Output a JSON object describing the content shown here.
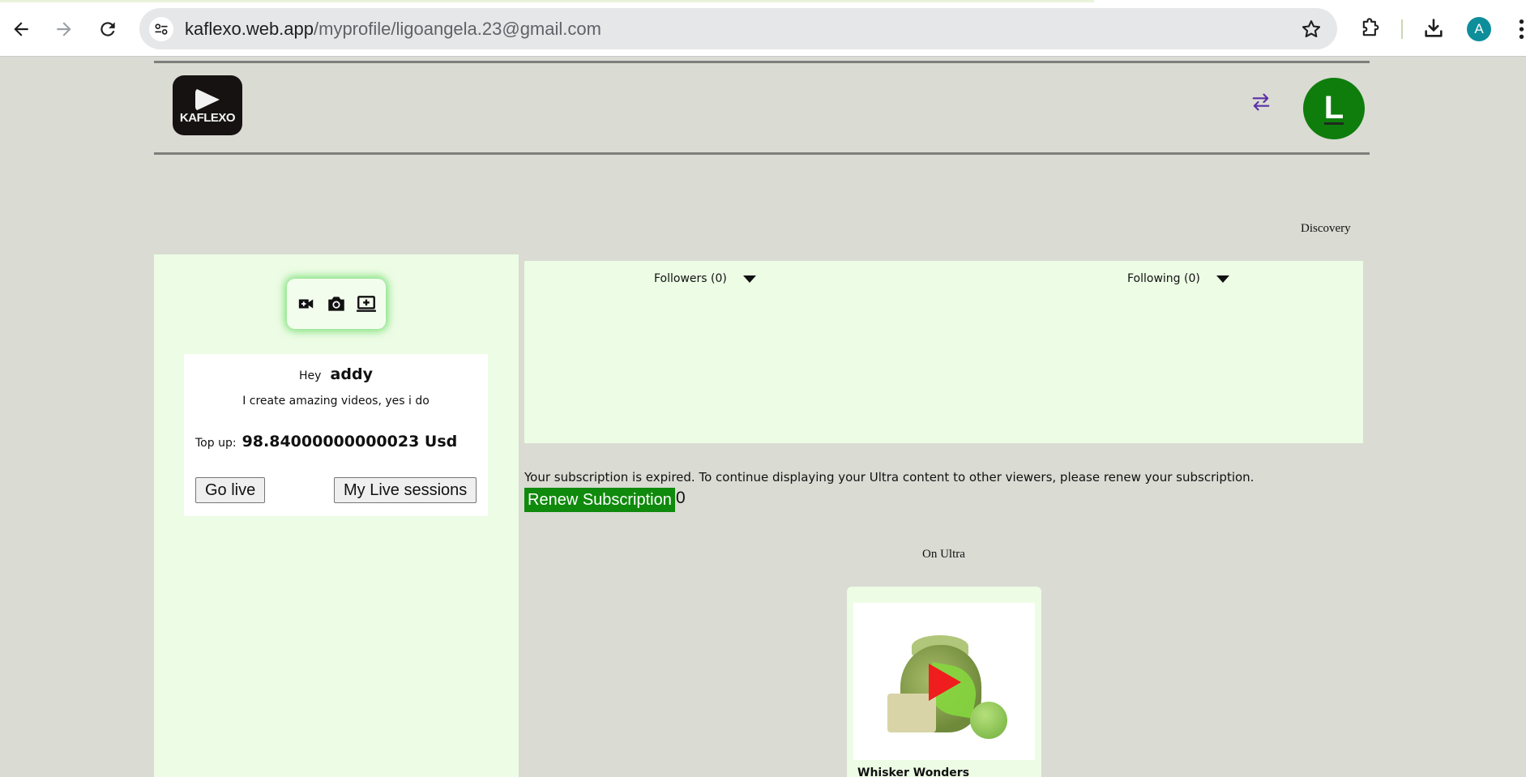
{
  "browser": {
    "url_host": "kaflexo.web.app",
    "url_path": "/myprofile/ligoangela.23@gmail.com",
    "profile_initial": "A",
    "icons": [
      "back-arrow-icon",
      "forward-arrow-icon",
      "reload-icon",
      "site-settings-icon",
      "bookmark-star-icon",
      "extensions-puzzle-icon",
      "download-icon",
      "more-vert-icon"
    ]
  },
  "header": {
    "logo_text": "KAFLEXO",
    "user_initial": "L",
    "discovery_label": "Discovery"
  },
  "profile": {
    "greeting": "Hey",
    "username": "addy",
    "bio": "I create amazing videos, yes i do",
    "topup_label": "Top up:",
    "topup_value": "98.84000000000023 Usd",
    "go_live_label": "Go live",
    "live_sessions_label": "My Live sessions"
  },
  "social": {
    "followers_label": "Followers (0)",
    "following_label": "Following (0)"
  },
  "subscription": {
    "message": "Your subscription is expired. To continue displaying your Ultra content to other viewers, please renew your subscription.",
    "renew_label": "Renew Subscription",
    "renew_count": "0"
  },
  "ultra": {
    "section_label": "On Ultra",
    "videos": [
      {
        "title": "Whisker Wonders"
      }
    ]
  },
  "colors": {
    "page_bg": "#dadbd3",
    "panel_bg": "#edfce5",
    "brand_green": "#0f8a0c",
    "avatar_green": "#0f7d0c",
    "accent_purple": "#5b2fa8",
    "play_red": "#ef1d1d"
  }
}
